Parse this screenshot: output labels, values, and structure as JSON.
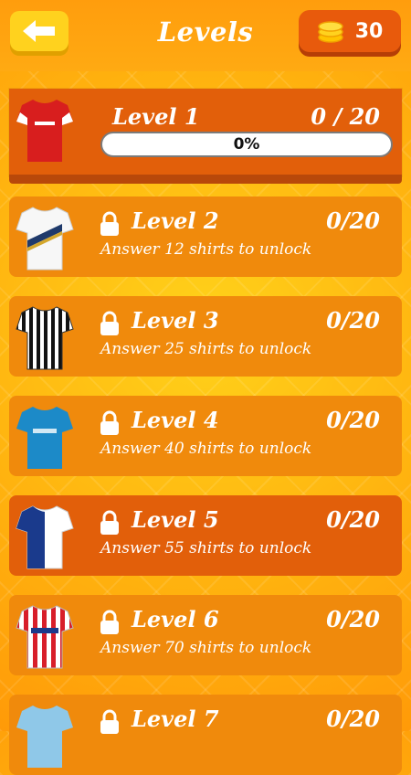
{
  "header": {
    "title": "Levels",
    "coins": "30",
    "back_icon": "arrow-left-icon",
    "coin_icon": "coin-stack-icon"
  },
  "colors": {
    "accent_orange": "#f08a0c",
    "active_orange": "#e25f0a",
    "back_yellow": "#ffd21e",
    "coin_gold": "#ffd21e"
  },
  "levels": [
    {
      "name": "Level 1",
      "progress": "0 / 20",
      "percent_label": "0%",
      "percent": 0,
      "locked": false,
      "shirt": "red-white-jersey"
    },
    {
      "name": "Level 2",
      "progress": "0/20",
      "unlock": "Answer 12 shirts to unlock",
      "locked": true,
      "shirt": "white-gold-jersey"
    },
    {
      "name": "Level 3",
      "progress": "0/20",
      "unlock": "Answer 25 shirts to unlock",
      "locked": true,
      "shirt": "black-white-striped-jersey"
    },
    {
      "name": "Level 4",
      "progress": "0/20",
      "unlock": "Answer 40 shirts to unlock",
      "locked": true,
      "shirt": "blue-jersey"
    },
    {
      "name": "Level 5",
      "progress": "0/20",
      "unlock": "Answer 55 shirts to unlock",
      "locked": true,
      "shirt": "blue-white-halves-jersey"
    },
    {
      "name": "Level 6",
      "progress": "0/20",
      "unlock": "Answer 70 shirts to unlock",
      "locked": true,
      "shirt": "red-white-striped-jersey"
    },
    {
      "name": "Level 7",
      "progress": "0/20",
      "locked": true,
      "shirt": "sky-blue-jersey"
    }
  ]
}
